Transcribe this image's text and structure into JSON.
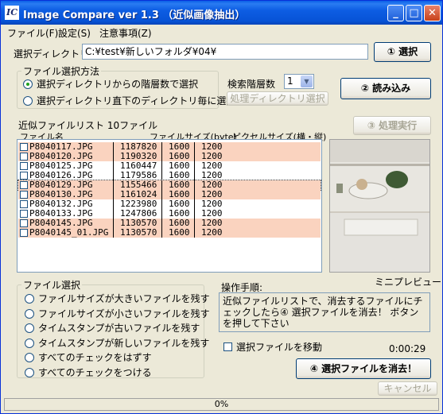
{
  "window": {
    "title": "Image Compare ver 1.3 （近似画像抽出）",
    "icon": "IC",
    "minimize": "_",
    "maximize": "□",
    "close": "✕"
  },
  "menu": [
    "ファイル(F)",
    "設定(S)",
    "注意事項(Z)"
  ],
  "directory": {
    "label": "選択ディレクトリ",
    "value": "C:¥test¥新しいフォルダ¥04¥",
    "select_button": "① 選択"
  },
  "file_select_method": {
    "title": "ファイル選択方法",
    "options": [
      {
        "label": "選択ディレクトリからの階層数で選択",
        "selected": true
      },
      {
        "label": "選択ディレクトリ直下のディレクトリ毎に選択",
        "selected": false
      }
    ]
  },
  "depth": {
    "label": "検索階層数",
    "value": "1"
  },
  "load_button": "② 読み込み",
  "process_dir_button": "処理ディレクトリ選択",
  "execute_button": "③ 処理実行",
  "file_list": {
    "title": "近似ファイルリスト 10ファイル",
    "headers": {
      "name": "ファイル名",
      "size": "ファイルサイズ(byte)",
      "pixel": "ピクセルサイズ(横・縦)"
    },
    "rows": [
      {
        "name": "P8040117.JPG",
        "size": "1187820",
        "w": "1600",
        "h": "1200",
        "highlight": true
      },
      {
        "name": "P8040120.JPG",
        "size": "1190320",
        "w": "1600",
        "h": "1200",
        "highlight": true
      },
      {
        "name": "P8040125.JPG",
        "size": "1160447",
        "w": "1600",
        "h": "1200",
        "highlight": false
      },
      {
        "name": "P8040126.JPG",
        "size": "1179586",
        "w": "1600",
        "h": "1200",
        "highlight": false
      },
      {
        "name": "P8040129.JPG",
        "size": "1155466",
        "w": "1600",
        "h": "1200",
        "highlight": true,
        "focus": true
      },
      {
        "name": "P8040130.JPG",
        "size": "1161024",
        "w": "1600",
        "h": "1200",
        "highlight": true
      },
      {
        "name": "P8040132.JPG",
        "size": "1223980",
        "w": "1600",
        "h": "1200",
        "highlight": false
      },
      {
        "name": "P8040133.JPG",
        "size": "1247806",
        "w": "1600",
        "h": "1200",
        "highlight": false
      },
      {
        "name": "P8040145.JPG",
        "size": "1130570",
        "w": "1600",
        "h": "1200",
        "highlight": true
      },
      {
        "name": "P8040145_01.JPG",
        "size": "1130570",
        "w": "1600",
        "h": "1200",
        "highlight": true
      }
    ]
  },
  "preview_label": "ミニプレビュー",
  "file_choice": {
    "title": "ファイル選択",
    "options": [
      "ファイルサイズが大きいファイルを残す",
      "ファイルサイズが小さいファイルを残す",
      "タイムスタンプが古いファイルを残す",
      "タイムスタンプが新しいファイルを残す",
      "すべてのチェックをはずす",
      "すべてのチェックをつける"
    ]
  },
  "procedure": {
    "label": "操作手順:",
    "text": "近似ファイルリストで、消去するファイルにチェックしたら④ 選択ファイルを消去！ ボタンを押して下さい"
  },
  "move_checkbox": "選択ファイルを移動",
  "timer": "0:00:29",
  "delete_button": "④ 選択ファイルを消去！",
  "cancel_button": "キャンセル",
  "progress": "0%",
  "colors": {
    "highlight_row": "#fad3bf",
    "titlebar": "#0753d6",
    "dialog": "#ece9d8"
  }
}
